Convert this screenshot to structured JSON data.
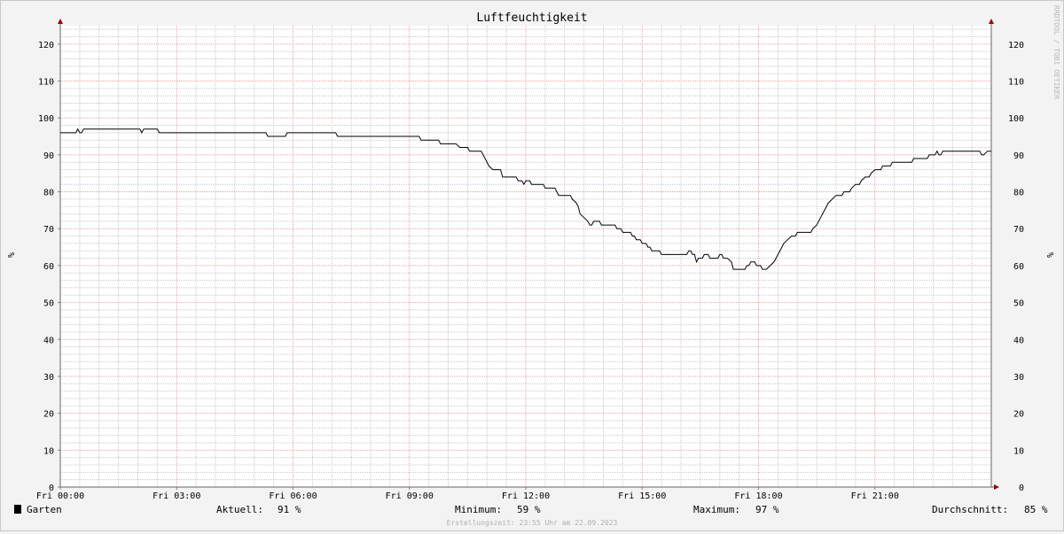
{
  "chart_data": {
    "type": "line",
    "title": "Luftfeuchtigkeit",
    "ylabel": "%",
    "ylim": [
      0,
      125
    ],
    "xlim": [
      0,
      24
    ],
    "yticks": [
      0,
      10,
      20,
      30,
      40,
      50,
      60,
      70,
      80,
      90,
      100,
      110,
      120
    ],
    "xticks": [
      {
        "x": 0,
        "label": "Fri 00:00"
      },
      {
        "x": 3,
        "label": "Fri 03:00"
      },
      {
        "x": 6,
        "label": "Fri 06:00"
      },
      {
        "x": 9,
        "label": "Fri 09:00"
      },
      {
        "x": 12,
        "label": "Fri 12:00"
      },
      {
        "x": 15,
        "label": "Fri 15:00"
      },
      {
        "x": 18,
        "label": "Fri 18:00"
      },
      {
        "x": 21,
        "label": "Fri 21:00"
      }
    ],
    "grid": true,
    "series": [
      {
        "name": "Garten",
        "color": "#000000",
        "points": [
          [
            0.0,
            96
          ],
          [
            0.4,
            96
          ],
          [
            0.45,
            97
          ],
          [
            0.5,
            96
          ],
          [
            0.55,
            96
          ],
          [
            0.6,
            97
          ],
          [
            2.05,
            97
          ],
          [
            2.1,
            96
          ],
          [
            2.15,
            97
          ],
          [
            2.5,
            97
          ],
          [
            2.55,
            96
          ],
          [
            5.3,
            96
          ],
          [
            5.35,
            95
          ],
          [
            5.8,
            95
          ],
          [
            5.85,
            96
          ],
          [
            7.1,
            96
          ],
          [
            7.15,
            95
          ],
          [
            9.25,
            95
          ],
          [
            9.3,
            94
          ],
          [
            9.75,
            94
          ],
          [
            9.8,
            93
          ],
          [
            10.2,
            93
          ],
          [
            10.3,
            92
          ],
          [
            10.5,
            92
          ],
          [
            10.55,
            91
          ],
          [
            10.85,
            91
          ],
          [
            10.95,
            89
          ],
          [
            11.05,
            87
          ],
          [
            11.15,
            86
          ],
          [
            11.35,
            86
          ],
          [
            11.4,
            84
          ],
          [
            11.75,
            84
          ],
          [
            11.8,
            83
          ],
          [
            11.9,
            83
          ],
          [
            11.95,
            82
          ],
          [
            12.0,
            83
          ],
          [
            12.1,
            83
          ],
          [
            12.15,
            82
          ],
          [
            12.45,
            82
          ],
          [
            12.5,
            81
          ],
          [
            12.75,
            81
          ],
          [
            12.8,
            80
          ],
          [
            12.85,
            79
          ],
          [
            13.15,
            79
          ],
          [
            13.2,
            78
          ],
          [
            13.3,
            77
          ],
          [
            13.35,
            76
          ],
          [
            13.4,
            74
          ],
          [
            13.5,
            73
          ],
          [
            13.6,
            72
          ],
          [
            13.65,
            71
          ],
          [
            13.7,
            71
          ],
          [
            13.75,
            72
          ],
          [
            13.9,
            72
          ],
          [
            13.95,
            71
          ],
          [
            14.3,
            71
          ],
          [
            14.35,
            70
          ],
          [
            14.45,
            70
          ],
          [
            14.5,
            69
          ],
          [
            14.7,
            69
          ],
          [
            14.75,
            68
          ],
          [
            14.8,
            68
          ],
          [
            14.85,
            67
          ],
          [
            14.95,
            67
          ],
          [
            15.0,
            66
          ],
          [
            15.1,
            66
          ],
          [
            15.15,
            65
          ],
          [
            15.2,
            65
          ],
          [
            15.25,
            64
          ],
          [
            15.45,
            64
          ],
          [
            15.5,
            63
          ],
          [
            16.15,
            63
          ],
          [
            16.2,
            64
          ],
          [
            16.25,
            64
          ],
          [
            16.3,
            63
          ],
          [
            16.35,
            63
          ],
          [
            16.4,
            61
          ],
          [
            16.45,
            62
          ],
          [
            16.55,
            62
          ],
          [
            16.6,
            63
          ],
          [
            16.7,
            63
          ],
          [
            16.75,
            62
          ],
          [
            16.95,
            62
          ],
          [
            17.0,
            63
          ],
          [
            17.05,
            63
          ],
          [
            17.1,
            62
          ],
          [
            17.2,
            62
          ],
          [
            17.3,
            61
          ],
          [
            17.35,
            59
          ],
          [
            17.65,
            59
          ],
          [
            17.7,
            60
          ],
          [
            17.75,
            60
          ],
          [
            17.8,
            61
          ],
          [
            17.9,
            61
          ],
          [
            17.95,
            60
          ],
          [
            18.05,
            60
          ],
          [
            18.1,
            59
          ],
          [
            18.2,
            59
          ],
          [
            18.3,
            60
          ],
          [
            18.4,
            61
          ],
          [
            18.45,
            62
          ],
          [
            18.5,
            63
          ],
          [
            18.6,
            65
          ],
          [
            18.65,
            66
          ],
          [
            18.75,
            67
          ],
          [
            18.85,
            68
          ],
          [
            18.95,
            68
          ],
          [
            19.0,
            69
          ],
          [
            19.35,
            69
          ],
          [
            19.4,
            70
          ],
          [
            19.5,
            71
          ],
          [
            19.6,
            73
          ],
          [
            19.7,
            75
          ],
          [
            19.8,
            77
          ],
          [
            19.9,
            78
          ],
          [
            20.0,
            79
          ],
          [
            20.15,
            79
          ],
          [
            20.2,
            80
          ],
          [
            20.35,
            80
          ],
          [
            20.4,
            81
          ],
          [
            20.5,
            82
          ],
          [
            20.6,
            82
          ],
          [
            20.65,
            83
          ],
          [
            20.75,
            84
          ],
          [
            20.85,
            84
          ],
          [
            20.9,
            85
          ],
          [
            21.0,
            86
          ],
          [
            21.15,
            86
          ],
          [
            21.2,
            87
          ],
          [
            21.4,
            87
          ],
          [
            21.45,
            88
          ],
          [
            21.95,
            88
          ],
          [
            22.0,
            89
          ],
          [
            22.35,
            89
          ],
          [
            22.4,
            90
          ],
          [
            22.55,
            90
          ],
          [
            22.6,
            91
          ],
          [
            22.65,
            90
          ],
          [
            22.7,
            90
          ],
          [
            22.75,
            91
          ],
          [
            23.7,
            91
          ],
          [
            23.75,
            90
          ],
          [
            23.8,
            90
          ],
          [
            23.9,
            91
          ],
          [
            24.0,
            91
          ]
        ]
      }
    ]
  },
  "legend": {
    "series_name": "Garten",
    "current_label": "Aktuell:",
    "current_value": "91 %",
    "min_label": "Minimum:",
    "min_value": "59 %",
    "max_label": "Maximum:",
    "max_value": "97 %",
    "avg_label": "Durchschnitt:",
    "avg_value": "85 %"
  },
  "footer": {
    "created": "Erstellungszeit: 23:55 Uhr am 22.09.2023"
  },
  "watermark": "RRDTOOL / TOBI OETIKER"
}
